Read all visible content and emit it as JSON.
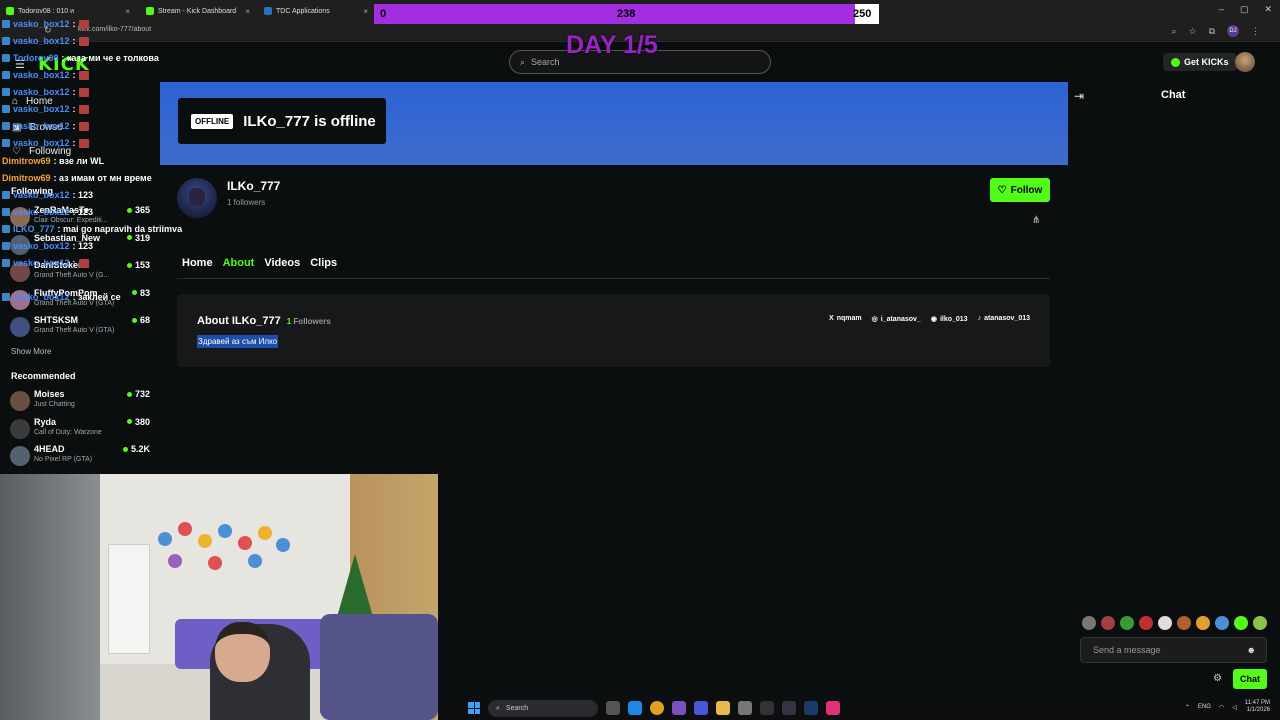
{
  "browser": {
    "tabs": [
      {
        "label": "Todorov08 : 010 и"
      },
      {
        "label": "Stream - Kick Dashboard"
      },
      {
        "label": "TDC Applications"
      }
    ],
    "url": "kick.com/ilko-777/about"
  },
  "overlay": {
    "progress_min": "0",
    "progress_current": "238",
    "progress_max": "250",
    "progress_fraction": 0.952,
    "day_label": "DAY 1/5"
  },
  "header": {
    "logo": "KICK",
    "search_placeholder": "Search",
    "get_kicks": "Get KICKs",
    "chat_title": "Chat"
  },
  "sidebar": {
    "home": "Home",
    "browse": "Browse",
    "following": "Following",
    "following_header": "Following",
    "show_more": "Show More",
    "recommended_header": "Recommended",
    "following_channels": [
      {
        "name": "ZenRaMasTe",
        "game": "Clair Obscur: Expediti...",
        "viewers": "365",
        "color": "#8a6a55"
      },
      {
        "name": "Sebastian_New",
        "game": "",
        "viewers": "319",
        "color": "#506070"
      },
      {
        "name": "DaniStoken",
        "game": "Grand Theft Auto V (G...",
        "viewers": "153",
        "color": "#704848"
      },
      {
        "name": "FluffyPomPom",
        "game": "Grand Theft Auto V (GTA)",
        "viewers": "83",
        "color": "#a07090"
      },
      {
        "name": "SHTSKSM",
        "game": "Grand Theft Auto V (GTA)",
        "viewers": "68",
        "color": "#405080"
      }
    ],
    "recommended_channels": [
      {
        "name": "Moises",
        "game": "Just Chatting",
        "viewers": "732",
        "color": "#6a5040"
      },
      {
        "name": "Ryda",
        "game": "Call of Duty: Warzone",
        "viewers": "380",
        "color": "#3a3a3a"
      },
      {
        "name": "4HEAD",
        "game": "No Pixel RP (GTA)",
        "viewers": "5.2K",
        "color": "#556070"
      }
    ]
  },
  "chat_overlay": [
    {
      "user": "vasko_box12",
      "msg": ":"
    },
    {
      "user": "vasko_box12",
      "msg": ":"
    },
    {
      "user": "Todorov08",
      "msg": ": каза ми че е толкова"
    },
    {
      "user": "vasko_box12",
      "msg": ":"
    },
    {
      "user": "vasko_box12",
      "msg": ":"
    },
    {
      "user": "vasko_box12",
      "msg": ":"
    },
    {
      "user": "vasko_box12",
      "msg": ":"
    },
    {
      "user": "vasko_box12",
      "msg": ":"
    },
    {
      "user": "Dimitrow69",
      "msg": ": взе ли WL"
    },
    {
      "user": "Dimitrow69",
      "msg": ": аз имам от мн време"
    },
    {
      "user": "vasko_box12",
      "msg": ": 123"
    },
    {
      "user": "vasko_box12",
      "msg": ": 123"
    },
    {
      "user": "ILKO_777",
      "msg": ": mai go napravih da striimva"
    },
    {
      "user": "vasko_box12",
      "msg": ": 123"
    },
    {
      "user": "vasko_box12",
      "msg": ":"
    },
    {
      "user": "vasko_box12",
      "msg": ": заклей се"
    }
  ],
  "channel": {
    "offline_badge": "OFFLINE",
    "offline_title": "ILKo_777 is offline",
    "name": "ILKo_777",
    "followers": "1 followers",
    "follow_label": "Follow",
    "tabs": [
      "Home",
      "About",
      "Videos",
      "Clips"
    ],
    "about_title": "About ILKo_777",
    "about_followers_count": "1",
    "about_followers_label": "Followers",
    "bio": "Здравей аз съм Илко",
    "socials": [
      {
        "icon": "X",
        "label": "nqmam"
      },
      {
        "icon": "◎",
        "label": "i_atanasov_"
      },
      {
        "icon": "◉",
        "label": "ilko_013"
      },
      {
        "icon": "♪",
        "label": "atanasov_013"
      }
    ]
  },
  "chat_panel": {
    "input_placeholder": "Send a message",
    "send_label": "Chat"
  },
  "taskbar": {
    "search": "Search",
    "lang": "ENG",
    "time": "11:47 PM",
    "date": "1/1/2026"
  }
}
